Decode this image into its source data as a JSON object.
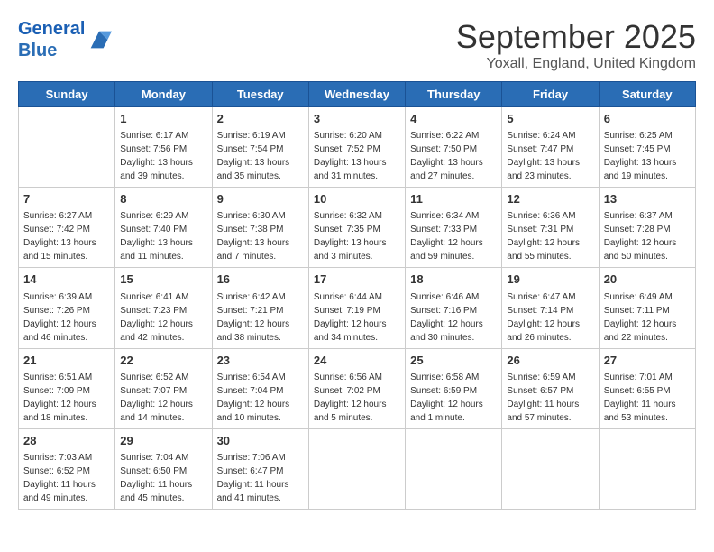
{
  "header": {
    "logo_line1": "General",
    "logo_line2": "Blue",
    "month": "September 2025",
    "location": "Yoxall, England, United Kingdom"
  },
  "days_of_week": [
    "Sunday",
    "Monday",
    "Tuesday",
    "Wednesday",
    "Thursday",
    "Friday",
    "Saturday"
  ],
  "weeks": [
    [
      {
        "day": "",
        "info": ""
      },
      {
        "day": "1",
        "info": "Sunrise: 6:17 AM\nSunset: 7:56 PM\nDaylight: 13 hours\nand 39 minutes."
      },
      {
        "day": "2",
        "info": "Sunrise: 6:19 AM\nSunset: 7:54 PM\nDaylight: 13 hours\nand 35 minutes."
      },
      {
        "day": "3",
        "info": "Sunrise: 6:20 AM\nSunset: 7:52 PM\nDaylight: 13 hours\nand 31 minutes."
      },
      {
        "day": "4",
        "info": "Sunrise: 6:22 AM\nSunset: 7:50 PM\nDaylight: 13 hours\nand 27 minutes."
      },
      {
        "day": "5",
        "info": "Sunrise: 6:24 AM\nSunset: 7:47 PM\nDaylight: 13 hours\nand 23 minutes."
      },
      {
        "day": "6",
        "info": "Sunrise: 6:25 AM\nSunset: 7:45 PM\nDaylight: 13 hours\nand 19 minutes."
      }
    ],
    [
      {
        "day": "7",
        "info": "Sunrise: 6:27 AM\nSunset: 7:42 PM\nDaylight: 13 hours\nand 15 minutes."
      },
      {
        "day": "8",
        "info": "Sunrise: 6:29 AM\nSunset: 7:40 PM\nDaylight: 13 hours\nand 11 minutes."
      },
      {
        "day": "9",
        "info": "Sunrise: 6:30 AM\nSunset: 7:38 PM\nDaylight: 13 hours\nand 7 minutes."
      },
      {
        "day": "10",
        "info": "Sunrise: 6:32 AM\nSunset: 7:35 PM\nDaylight: 13 hours\nand 3 minutes."
      },
      {
        "day": "11",
        "info": "Sunrise: 6:34 AM\nSunset: 7:33 PM\nDaylight: 12 hours\nand 59 minutes."
      },
      {
        "day": "12",
        "info": "Sunrise: 6:36 AM\nSunset: 7:31 PM\nDaylight: 12 hours\nand 55 minutes."
      },
      {
        "day": "13",
        "info": "Sunrise: 6:37 AM\nSunset: 7:28 PM\nDaylight: 12 hours\nand 50 minutes."
      }
    ],
    [
      {
        "day": "14",
        "info": "Sunrise: 6:39 AM\nSunset: 7:26 PM\nDaylight: 12 hours\nand 46 minutes."
      },
      {
        "day": "15",
        "info": "Sunrise: 6:41 AM\nSunset: 7:23 PM\nDaylight: 12 hours\nand 42 minutes."
      },
      {
        "day": "16",
        "info": "Sunrise: 6:42 AM\nSunset: 7:21 PM\nDaylight: 12 hours\nand 38 minutes."
      },
      {
        "day": "17",
        "info": "Sunrise: 6:44 AM\nSunset: 7:19 PM\nDaylight: 12 hours\nand 34 minutes."
      },
      {
        "day": "18",
        "info": "Sunrise: 6:46 AM\nSunset: 7:16 PM\nDaylight: 12 hours\nand 30 minutes."
      },
      {
        "day": "19",
        "info": "Sunrise: 6:47 AM\nSunset: 7:14 PM\nDaylight: 12 hours\nand 26 minutes."
      },
      {
        "day": "20",
        "info": "Sunrise: 6:49 AM\nSunset: 7:11 PM\nDaylight: 12 hours\nand 22 minutes."
      }
    ],
    [
      {
        "day": "21",
        "info": "Sunrise: 6:51 AM\nSunset: 7:09 PM\nDaylight: 12 hours\nand 18 minutes."
      },
      {
        "day": "22",
        "info": "Sunrise: 6:52 AM\nSunset: 7:07 PM\nDaylight: 12 hours\nand 14 minutes."
      },
      {
        "day": "23",
        "info": "Sunrise: 6:54 AM\nSunset: 7:04 PM\nDaylight: 12 hours\nand 10 minutes."
      },
      {
        "day": "24",
        "info": "Sunrise: 6:56 AM\nSunset: 7:02 PM\nDaylight: 12 hours\nand 5 minutes."
      },
      {
        "day": "25",
        "info": "Sunrise: 6:58 AM\nSunset: 6:59 PM\nDaylight: 12 hours\nand 1 minute."
      },
      {
        "day": "26",
        "info": "Sunrise: 6:59 AM\nSunset: 6:57 PM\nDaylight: 11 hours\nand 57 minutes."
      },
      {
        "day": "27",
        "info": "Sunrise: 7:01 AM\nSunset: 6:55 PM\nDaylight: 11 hours\nand 53 minutes."
      }
    ],
    [
      {
        "day": "28",
        "info": "Sunrise: 7:03 AM\nSunset: 6:52 PM\nDaylight: 11 hours\nand 49 minutes."
      },
      {
        "day": "29",
        "info": "Sunrise: 7:04 AM\nSunset: 6:50 PM\nDaylight: 11 hours\nand 45 minutes."
      },
      {
        "day": "30",
        "info": "Sunrise: 7:06 AM\nSunset: 6:47 PM\nDaylight: 11 hours\nand 41 minutes."
      },
      {
        "day": "",
        "info": ""
      },
      {
        "day": "",
        "info": ""
      },
      {
        "day": "",
        "info": ""
      },
      {
        "day": "",
        "info": ""
      }
    ]
  ]
}
